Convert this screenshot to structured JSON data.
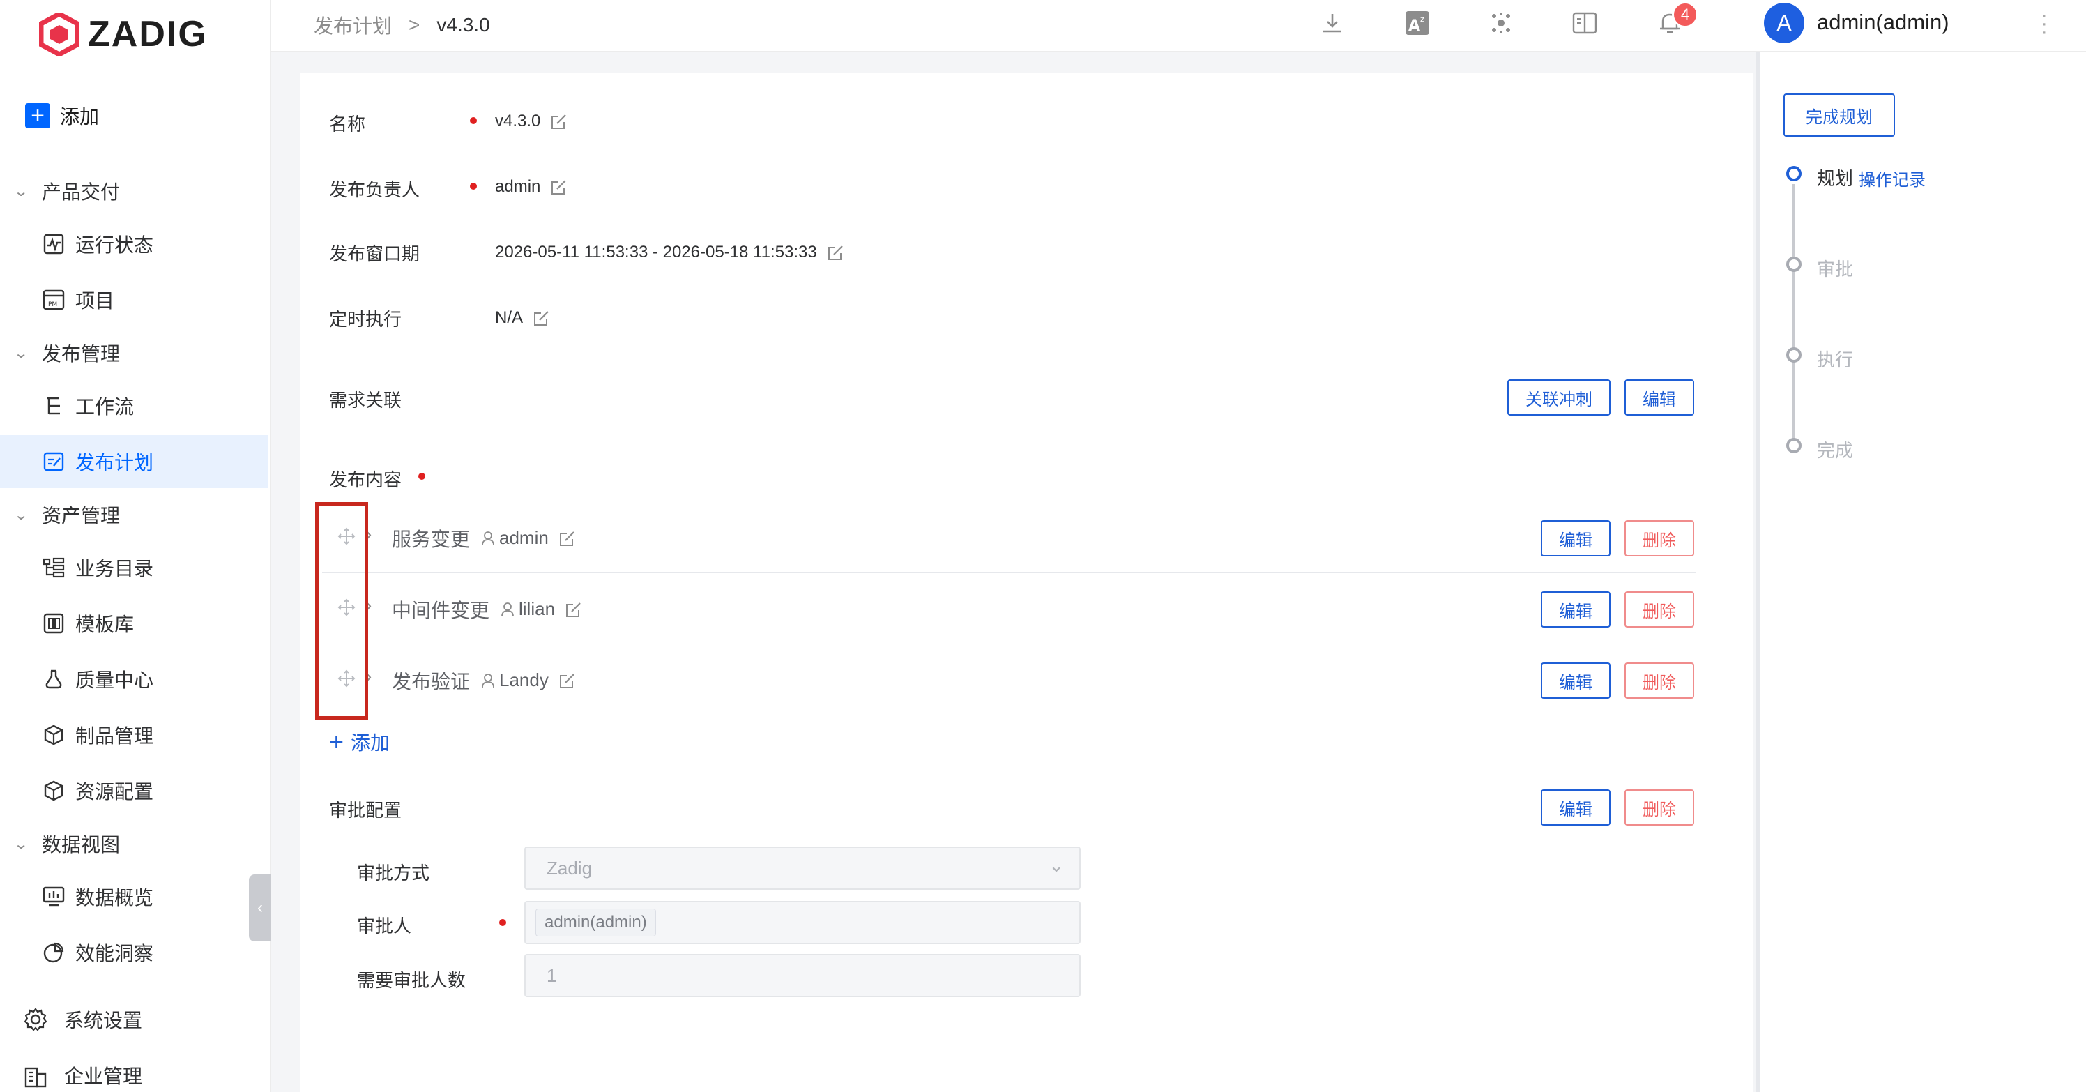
{
  "app": {
    "logo_text": "ZADIG",
    "brand_color": "#0066ff"
  },
  "sidebar": {
    "add_label": "添加",
    "groups": [
      {
        "label": "产品交付"
      },
      {
        "label": "发布管理"
      },
      {
        "label": "资产管理"
      },
      {
        "label": "数据视图"
      }
    ],
    "items": [
      {
        "label": "运行状态",
        "icon": "pulse-icon"
      },
      {
        "label": "项目",
        "icon": "pm-icon"
      },
      {
        "label": "工作流",
        "icon": "workflow-icon"
      },
      {
        "label": "发布计划",
        "icon": "plan-icon",
        "active": true
      },
      {
        "label": "业务目录",
        "icon": "catalog-icon"
      },
      {
        "label": "模板库",
        "icon": "template-icon"
      },
      {
        "label": "质量中心",
        "icon": "quality-icon"
      },
      {
        "label": "制品管理",
        "icon": "artifact-icon"
      },
      {
        "label": "资源配置",
        "icon": "resource-icon"
      },
      {
        "label": "数据概览",
        "icon": "dashboard-icon"
      },
      {
        "label": "效能洞察",
        "icon": "pie-icon"
      }
    ],
    "bottom": [
      {
        "label": "系统设置",
        "icon": "gear-icon"
      },
      {
        "label": "企业管理",
        "icon": "building-icon"
      }
    ]
  },
  "topbar": {
    "breadcrumb": {
      "parent": "发布计划",
      "separator": ">",
      "current": "v4.3.0"
    },
    "notification_count": "4",
    "avatar_letter": "A",
    "username": "admin(admin)"
  },
  "plan": {
    "name_label": "名称",
    "name_value": "v4.3.0",
    "owner_label": "发布负责人",
    "owner_value": "admin",
    "window_label": "发布窗口期",
    "window_value": "2026-05-11 11:53:33 - 2026-05-18 11:53:33",
    "schedule_label": "定时执行",
    "schedule_value": "N/A",
    "requirement_label": "需求关联",
    "link_sprint_button": "关联冲刺",
    "edit_button": "编辑",
    "delete_button": "删除",
    "content_label": "发布内容",
    "content_rows": [
      {
        "title": "服务变更",
        "owner": "admin"
      },
      {
        "title": "中间件变更",
        "owner": "lilian"
      },
      {
        "title": "发布验证",
        "owner": "Landy"
      }
    ],
    "add_content_label": "添加",
    "approval_label": "审批配置",
    "approval_method_label": "审批方式",
    "approval_method_value": "Zadig",
    "approver_label": "审批人",
    "approver_value": "admin(admin)",
    "required_approvers_label": "需要审批人数",
    "required_approvers_value": "1"
  },
  "steps_panel": {
    "finish_button": "完成规划",
    "steps": [
      {
        "label": "规划",
        "active": true
      },
      {
        "label": "审批"
      },
      {
        "label": "执行"
      },
      {
        "label": "完成"
      }
    ],
    "log_link": "操作记录"
  }
}
